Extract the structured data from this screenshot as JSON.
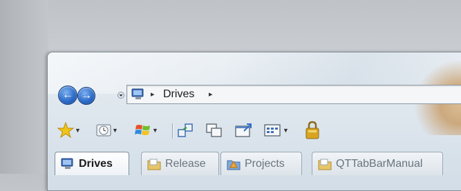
{
  "address_bar": {
    "breadcrumb_label": "Drives"
  },
  "toolbar": {
    "buttons": [
      "favorites-star-icon",
      "clock-icon",
      "windows-flag-icon",
      "network-icon",
      "windows-icon",
      "arrow-window-icon",
      "grid-window-icon",
      "lock-icon"
    ]
  },
  "tabs": [
    {
      "label": "Drives",
      "active": true
    },
    {
      "label": "Release",
      "active": false
    },
    {
      "label": "Projects",
      "active": false
    },
    {
      "label": "QTTabBarManual",
      "active": false
    }
  ],
  "colors": {
    "nav_blue": "#2d6cc9",
    "star_yellow": "#f2c418",
    "lock_gold": "#d9a521"
  }
}
